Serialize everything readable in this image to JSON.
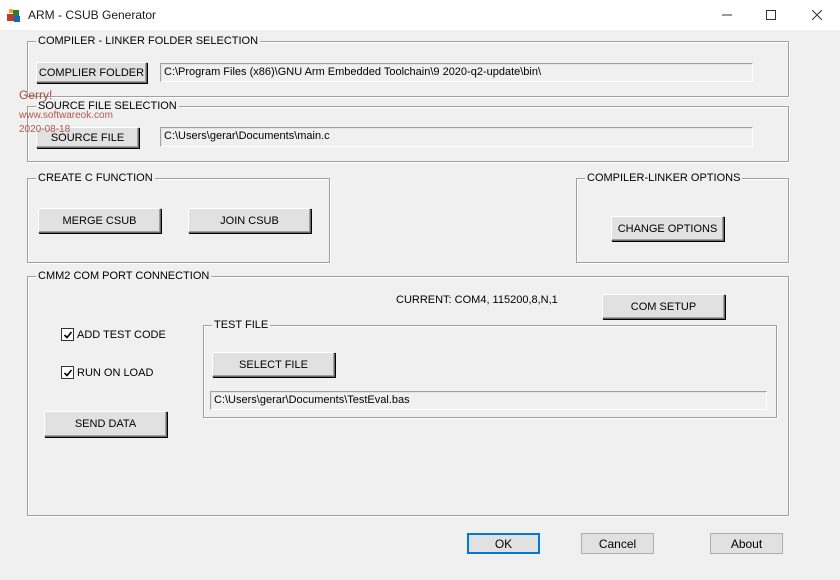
{
  "window": {
    "title": "ARM - CSUB Generator",
    "minimize_glyph": "—",
    "maximize_glyph": "☐",
    "close_glyph": "✕"
  },
  "compiler_folder": {
    "group_title": "COMPILER - LINKER FOLDER SELECTION",
    "button_label": "COMPLIER FOLDER",
    "path_value": "C:\\Program Files (x86)\\GNU Arm Embedded Toolchain\\9 2020-q2-update\\bin\\"
  },
  "source_file": {
    "group_title": "SOURCE FILE SELECTION",
    "button_label": "SOURCE FILE",
    "path_value": "C:\\Users\\gerar\\Documents\\main.c"
  },
  "create_c_function": {
    "group_title": "CREATE C FUNCTION",
    "merge_label": "MERGE CSUB",
    "join_label": "JOIN CSUB"
  },
  "compiler_options": {
    "group_title": "COMPILER-LINKER OPTIONS",
    "change_label": "CHANGE OPTIONS"
  },
  "com_port": {
    "group_title": "CMM2 COM PORT CONNECTION",
    "current_text": "CURRENT: COM4, 115200,8,N,1",
    "com_setup_label": "COM SETUP",
    "add_test_code_label": "ADD TEST CODE",
    "add_test_code_checked": true,
    "run_on_load_label": "RUN ON LOAD",
    "run_on_load_checked": true,
    "send_data_label": "SEND DATA",
    "test_file": {
      "group_title": "TEST FILE",
      "select_label": "SELECT FILE",
      "path_value": "C:\\Users\\gerar\\Documents\\TestEval.bas"
    }
  },
  "footer": {
    "ok_label": "OK",
    "cancel_label": "Cancel",
    "about_label": "About"
  },
  "watermark": {
    "name": "Gerry!",
    "site": "www.softwareok.com",
    "date": "2020-08-18"
  },
  "colors": {
    "focus_border": "#0078d7",
    "watermark": "#a64b3c"
  }
}
